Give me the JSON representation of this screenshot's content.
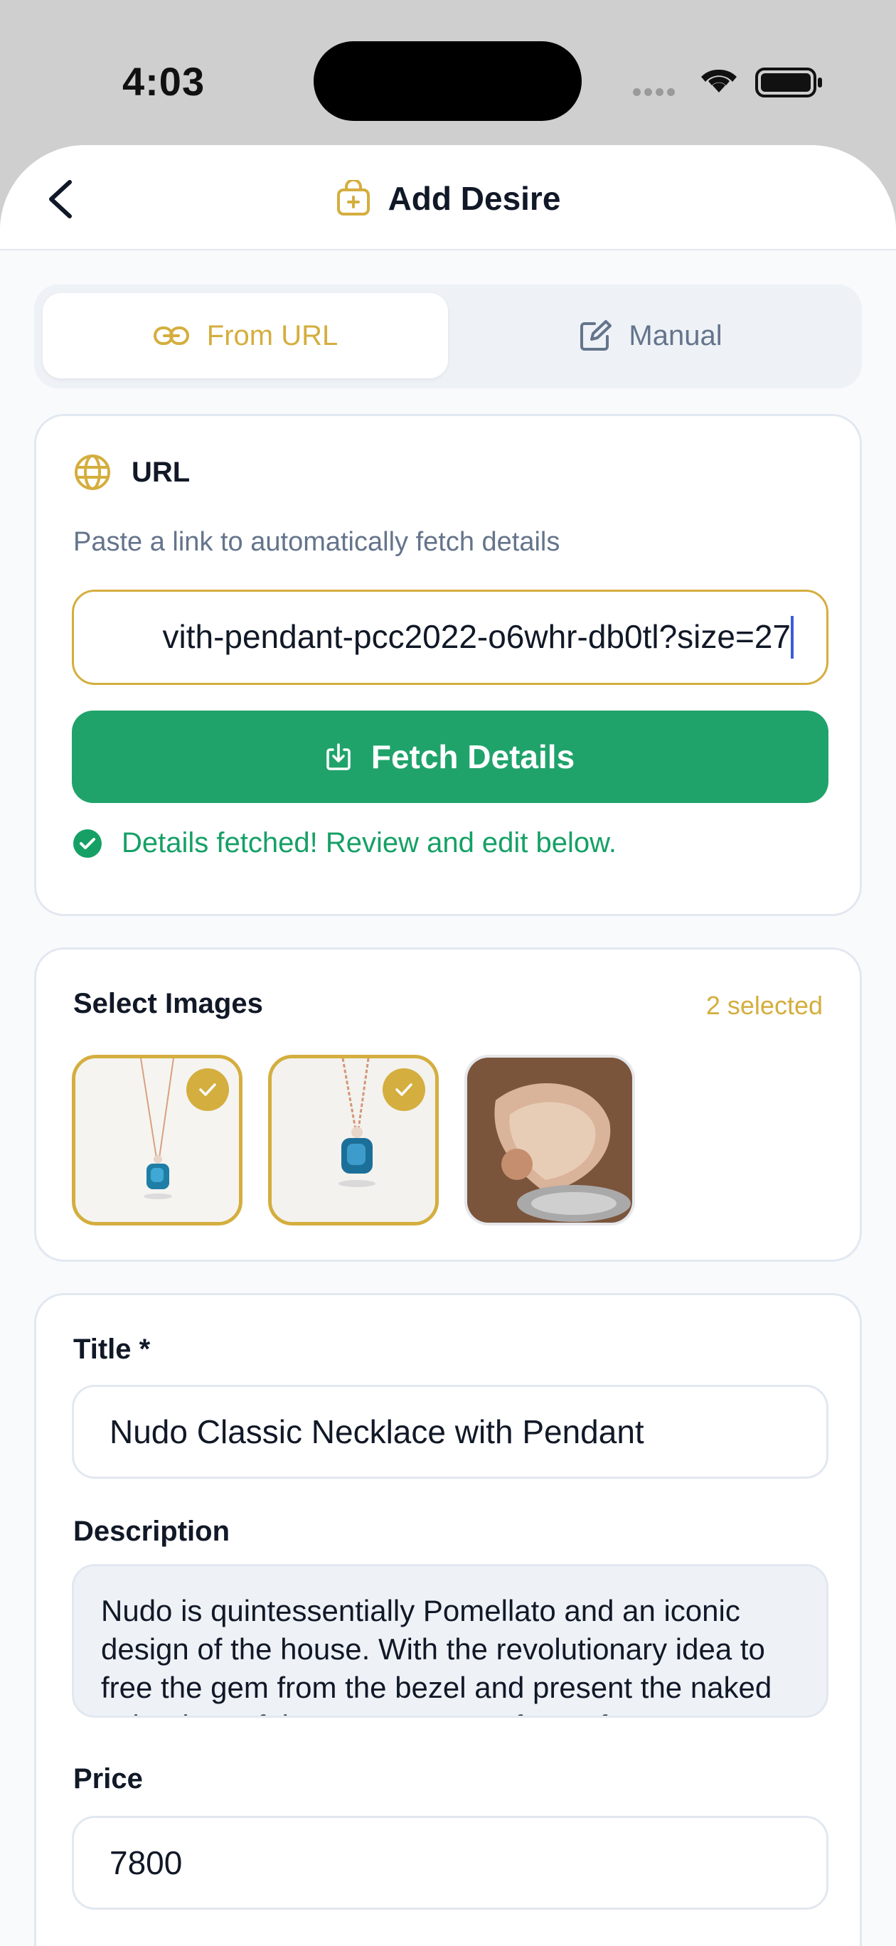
{
  "status_bar": {
    "time": "4:03"
  },
  "nav": {
    "title": "Add Desire"
  },
  "tabs": [
    {
      "label": "From URL",
      "active": true
    },
    {
      "label": "Manual",
      "active": false
    }
  ],
  "url_section": {
    "label": "URL",
    "hint": "Paste a link to automatically fetch details",
    "value": "vith-pendant-pcc2022-o6whr-db0tl?size=27",
    "fetch_label": "Fetch Details",
    "success_message": "Details fetched! Review and edit below."
  },
  "images": {
    "title": "Select Images",
    "count_label": "2 selected",
    "items": [
      {
        "name": "necklace-front",
        "selected": true
      },
      {
        "name": "necklace-angle",
        "selected": true
      },
      {
        "name": "pave-heart-closeup",
        "selected": false
      }
    ]
  },
  "form": {
    "title_label": "Title *",
    "title_value": "Nudo Classic Necklace with Pendant",
    "description_label": "Description",
    "description_value": "Nudo is quintessentially Pomellato and an iconic design of the house. With the revolutionary idea to free the gem from the bezel and present the naked splendour of the gem as an art form of",
    "price_label": "Price",
    "price_value": "7800"
  },
  "colors": {
    "accent": "#d4ae3e",
    "primary_button": "#20a36b",
    "success": "#16a066",
    "muted_text": "#64748b"
  }
}
